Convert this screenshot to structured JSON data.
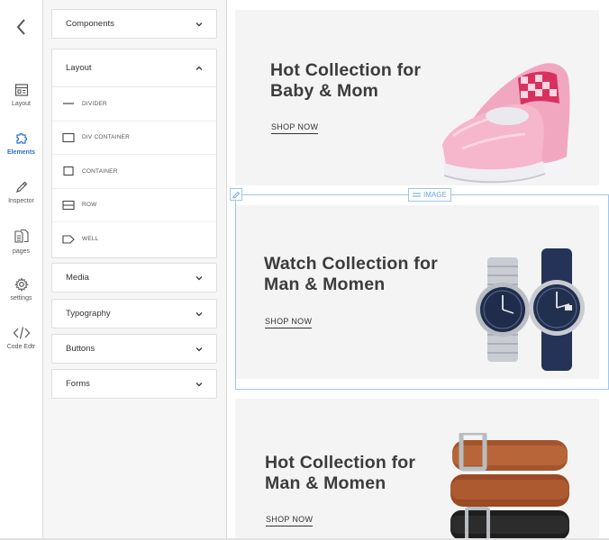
{
  "rail": {
    "items": [
      {
        "label": "Layout",
        "icon": "layout-icon"
      },
      {
        "label": "Elements",
        "icon": "puzzle-icon",
        "active": true
      },
      {
        "label": "Inspector",
        "icon": "pen-icon"
      },
      {
        "label": "pages",
        "icon": "pages-icon"
      },
      {
        "label": "settings",
        "icon": "gear-icon"
      },
      {
        "label": "Code Edtr",
        "icon": "code-icon"
      }
    ],
    "accent": "#2b6fc6"
  },
  "panel": {
    "components": "Components",
    "layout": {
      "title": "Layout",
      "items": [
        "DIVIDER",
        "DIV CONTAINER",
        "CONTAINER",
        "ROW",
        "WELL"
      ]
    },
    "media": "Media",
    "typography": "Typography",
    "buttons": "Buttons",
    "forms": "Forms"
  },
  "canvas": {
    "banners": [
      {
        "title": "Hot Collection for\nBaby & Mom",
        "cta": "SHOP NOW"
      },
      {
        "title": "Watch Collection for\nMan & Momen",
        "cta": "SHOP NOW"
      },
      {
        "title": "Hot Collection for\nMan & Momen",
        "cta": "SHOP NOW"
      }
    ],
    "selection_label": "IMAGE",
    "selection_color": "#9cc7ec"
  }
}
